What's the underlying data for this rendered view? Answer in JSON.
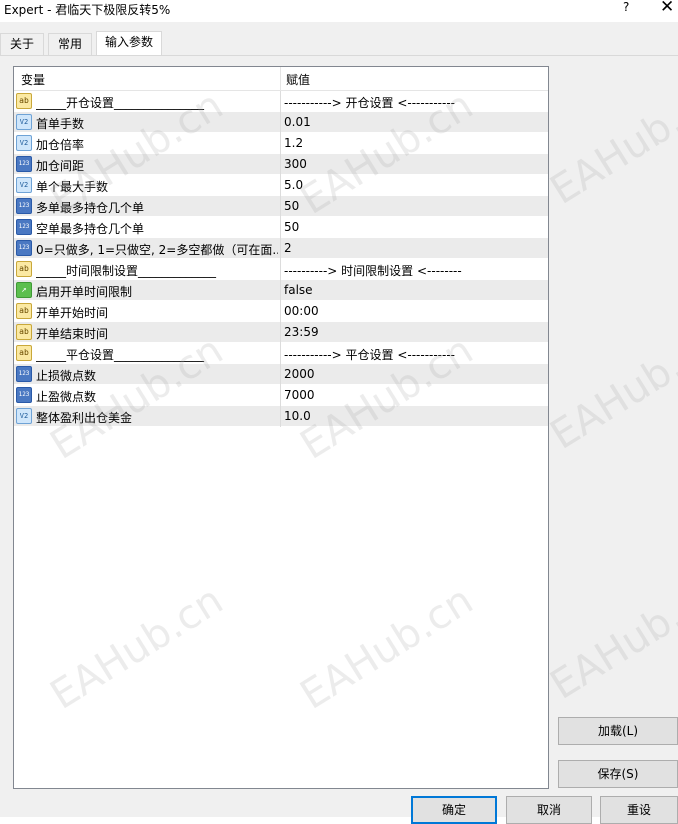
{
  "window": {
    "title": "Expert - 君临天下极限反转5%",
    "help": "?",
    "close": "✕"
  },
  "tabs": [
    {
      "label": "关于"
    },
    {
      "label": "常用"
    },
    {
      "label": "输入参数"
    }
  ],
  "table": {
    "col_name": "变量",
    "col_value": "赋值",
    "rows": [
      {
        "icon": "ab",
        "name": "_____开仓设置_______________",
        "value": "-----------> 开仓设置 <-----------"
      },
      {
        "icon": "V2",
        "name": "首单手数",
        "value": "0.01"
      },
      {
        "icon": "V2",
        "name": "加仓倍率",
        "value": "1.2"
      },
      {
        "icon": "123",
        "name": "加仓间距",
        "value": "300"
      },
      {
        "icon": "V2",
        "name": "单个最大手数",
        "value": "5.0"
      },
      {
        "icon": "123",
        "name": "多单最多持仓几个单",
        "value": "50"
      },
      {
        "icon": "123",
        "name": "空单最多持仓几个单",
        "value": "50"
      },
      {
        "icon": "123",
        "name": "0=只做多, 1=只做空, 2=多空都做（可在面...",
        "value": "2"
      },
      {
        "icon": "ab",
        "name": "_____时间限制设置_____________",
        "value": "----------> 时间限制设置 <--------"
      },
      {
        "icon": "bool",
        "name": "启用开单时间限制",
        "value": "false"
      },
      {
        "icon": "ab",
        "name": "开单开始时间",
        "value": "00:00"
      },
      {
        "icon": "ab",
        "name": "开单结束时间",
        "value": "23:59"
      },
      {
        "icon": "ab",
        "name": "_____平仓设置_______________",
        "value": "-----------> 平仓设置 <-----------"
      },
      {
        "icon": "123",
        "name": "止损微点数",
        "value": "2000"
      },
      {
        "icon": "123",
        "name": "止盈微点数",
        "value": "7000"
      },
      {
        "icon": "V2",
        "name": "整体盈利出仓美金",
        "value": "10.0"
      }
    ]
  },
  "buttons": {
    "load": "加载(L)",
    "save": "保存(S)",
    "ok": "确定",
    "cancel": "取消",
    "reset": "重设"
  },
  "watermark": "EAHub.cn"
}
